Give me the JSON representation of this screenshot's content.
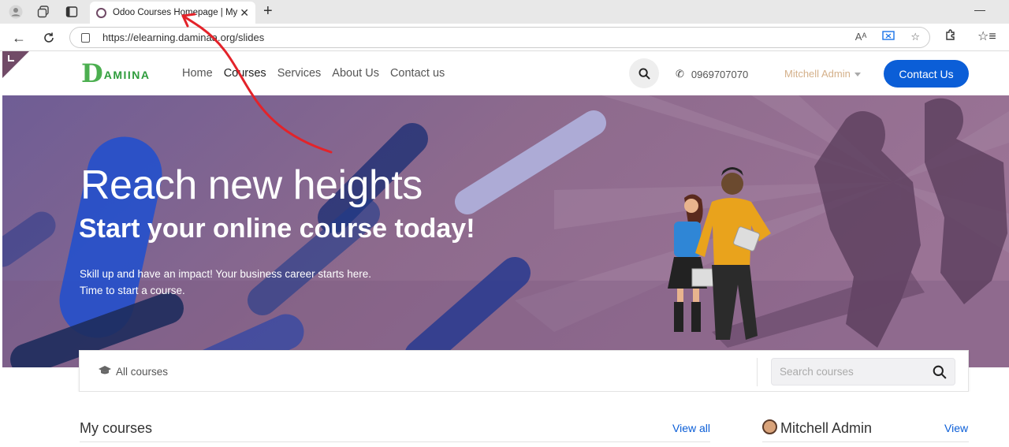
{
  "browser": {
    "tab_title": "Odoo Courses Homepage | My W",
    "url": "https://elearning.daminaa.org/slides",
    "read_aloud_label": "Aᴬ"
  },
  "header": {
    "logo_d": "D",
    "logo_rest": "AMIINA",
    "nav": [
      "Home",
      "Courses",
      "Services",
      "About Us",
      "Contact us"
    ],
    "active_nav": "Courses",
    "phone": "0969707070",
    "user_name": "Mitchell Admin",
    "contact_button": "Contact Us",
    "colors": {
      "brand": "#714B67",
      "primary": "#0b5ed7",
      "logo_green": "#4caf50"
    }
  },
  "hero": {
    "title": "Reach new heights",
    "subtitle": "Start your online course today!",
    "text_line1": "Skill up and have an impact! Your business career starts here.",
    "text_line2": "Time to start a course."
  },
  "search_panel": {
    "all_courses": "All courses",
    "placeholder": "Search courses"
  },
  "sections": {
    "my_courses": "My courses",
    "view_all": "View all",
    "profile_name": "Mitchell Admin",
    "profile_view": "View"
  },
  "icons": [
    "profile-icon",
    "workspaces-icon",
    "tab-actions-icon",
    "close-icon",
    "plus-icon",
    "back-icon",
    "refresh-icon",
    "lock-icon",
    "read-aloud-icon",
    "translate-icon",
    "favorite-star-icon",
    "extensions-icon",
    "favorites-icon",
    "search-icon",
    "phone-icon",
    "graduation-cap-icon",
    "avatar-icon"
  ]
}
